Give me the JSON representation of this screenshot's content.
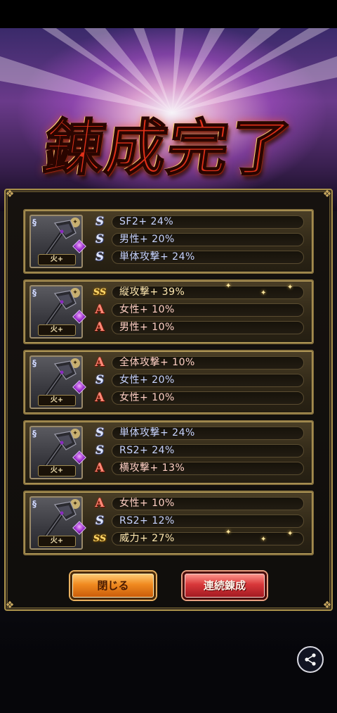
{
  "title": "錬成完了",
  "cards": [
    {
      "element": "火+",
      "rows": [
        {
          "rank": "S",
          "rank_icon": "s-rank-icon",
          "text": "SF2+ 24%"
        },
        {
          "rank": "S",
          "rank_icon": "s-rank-icon",
          "text": "男性+ 20%"
        },
        {
          "rank": "S",
          "rank_icon": "s-rank-icon",
          "text": "単体攻撃+ 24%"
        }
      ]
    },
    {
      "element": "火+",
      "rows": [
        {
          "rank": "SS",
          "rank_icon": "ss-rank-icon",
          "text": "縦攻撃+ 39%"
        },
        {
          "rank": "A",
          "rank_icon": "a-rank-icon",
          "text": "女性+ 10%"
        },
        {
          "rank": "A",
          "rank_icon": "a-rank-icon",
          "text": "男性+ 10%"
        }
      ]
    },
    {
      "element": "火+",
      "rows": [
        {
          "rank": "A",
          "rank_icon": "a-rank-icon",
          "text": "全体攻撃+ 10%"
        },
        {
          "rank": "S",
          "rank_icon": "s-rank-icon",
          "text": "女性+ 20%"
        },
        {
          "rank": "A",
          "rank_icon": "a-rank-icon",
          "text": "女性+ 10%"
        }
      ]
    },
    {
      "element": "火+",
      "rows": [
        {
          "rank": "S",
          "rank_icon": "s-rank-icon",
          "text": "単体攻撃+ 24%"
        },
        {
          "rank": "S",
          "rank_icon": "s-rank-icon",
          "text": "RS2+ 24%"
        },
        {
          "rank": "A",
          "rank_icon": "a-rank-icon",
          "text": "横攻撃+ 13%"
        }
      ]
    },
    {
      "element": "火+",
      "rows": [
        {
          "rank": "A",
          "rank_icon": "a-rank-icon",
          "text": "女性+ 10%"
        },
        {
          "rank": "S",
          "rank_icon": "s-rank-icon",
          "text": "RS2+ 12%"
        },
        {
          "rank": "SS",
          "rank_icon": "ss-rank-icon",
          "text": "威力+ 27%"
        }
      ]
    }
  ],
  "buttons": {
    "close_label": "閉じる",
    "continue_label": "連続錬成"
  },
  "icons": {
    "share": "share-icon"
  },
  "colors": {
    "title_red": "#e03018",
    "frame_gold": "#a8904a",
    "close_button": "#f08a20",
    "continue_button": "#d8383a"
  }
}
